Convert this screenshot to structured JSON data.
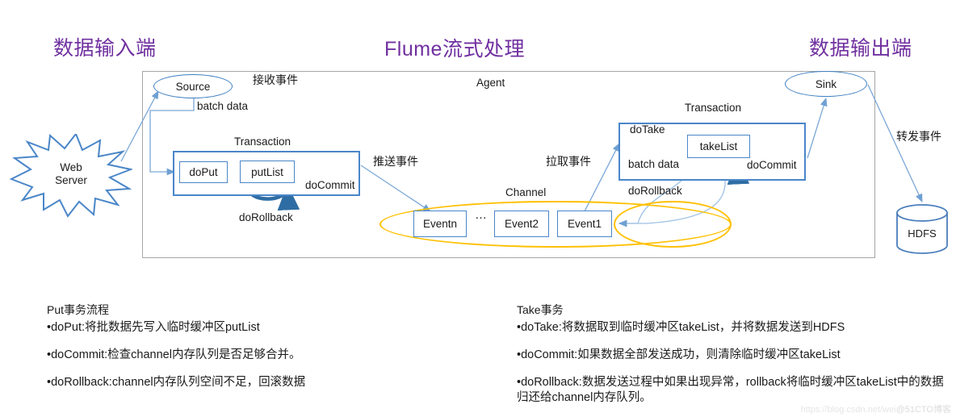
{
  "headers": {
    "input": "数据输入端",
    "middle": "Flume流式处理",
    "output": "数据输出端",
    "color": "#7030A0"
  },
  "diagram": {
    "agent_label": "Agent",
    "nodes": {
      "web_server_line1": "Web",
      "web_server_line2": "Server",
      "source": "Source",
      "sink": "Sink",
      "hdfs": "HDFS",
      "do_put": "doPut",
      "put_list": "putList",
      "take_list": "takeList",
      "event_n": "Eventn",
      "event_2": "Event2",
      "event_1": "Event1",
      "ellipsis": "…"
    },
    "labels": {
      "receive_event": "接收事件",
      "batch_data_left": "batch data",
      "transaction_left": "Transaction",
      "do_commit_left": "doCommit",
      "do_rollback_left": "doRollback",
      "push_event": "推送事件",
      "channel": "Channel",
      "pull_event": "拉取事件",
      "transaction_right": "Transaction",
      "do_take": "doTake",
      "batch_data_right": "batch data",
      "do_commit_right": "doCommit",
      "do_rollback_right": "doRollback",
      "forward_event": "转发事件"
    },
    "colors": {
      "accent_blue": "#4a86c8",
      "arrow_blue": "#7ba7d7",
      "deep_blue": "#2E6DA4",
      "channel_orange": "#FFC000",
      "frame_gray": "#a6a6a6"
    }
  },
  "notes": {
    "put": {
      "title": "Put事务流程",
      "items": [
        "•doPut:将批数据先写入临时缓冲区putList",
        "•doCommit:检查channel内存队列是否足够合并。",
        "•doRollback:channel内存队列空间不足，回滚数据"
      ]
    },
    "take": {
      "title": " Take事务",
      "items": [
        "•doTake:将数据取到临时缓冲区takeList，并将数据发送到HDFS",
        "•doCommit:如果数据全部发送成功，则清除临时缓冲区takeList",
        "•doRollback:数据发送过程中如果出现异常，rollback将临时缓冲区takeList中的数据归还给channel内存队列。"
      ]
    }
  },
  "watermark": {
    "url": "https://blog.csdn.net/wei",
    "brand": "@51CTO博客"
  }
}
